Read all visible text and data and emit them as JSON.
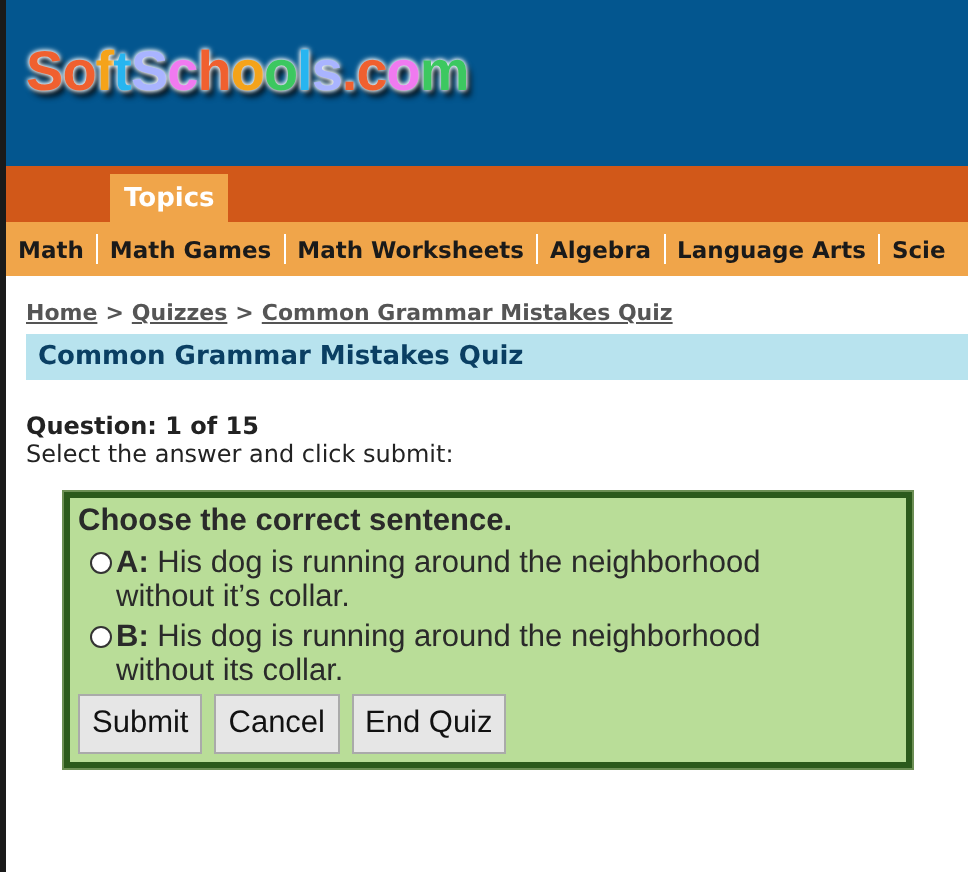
{
  "header": {
    "logo": "SoftSchools.com"
  },
  "tabs": [
    {
      "label": "Topics",
      "selected": true
    }
  ],
  "nav": [
    "Math",
    "Math Games",
    "Math Worksheets",
    "Algebra",
    "Language Arts",
    "Scie"
  ],
  "breadcrumb": [
    {
      "label": "Home"
    },
    {
      "label": "Quizzes"
    },
    {
      "label": "Common Grammar Mistakes Quiz"
    }
  ],
  "breadcrumb_separator": ">",
  "page_title": "Common Grammar Mistakes Quiz",
  "question_counter": "Question: 1 of 15",
  "instruction": "Select the answer and click submit:",
  "quiz": {
    "prompt": "Choose the correct sentence.",
    "options": [
      {
        "letter": "A:",
        "text": "His dog is running around the neighborhood without it’s collar.",
        "selected": false
      },
      {
        "letter": "B:",
        "text": "His dog is running around the neighborhood without its collar.",
        "selected": false
      }
    ],
    "buttons": [
      "Submit",
      "Cancel",
      "End Quiz"
    ]
  }
}
